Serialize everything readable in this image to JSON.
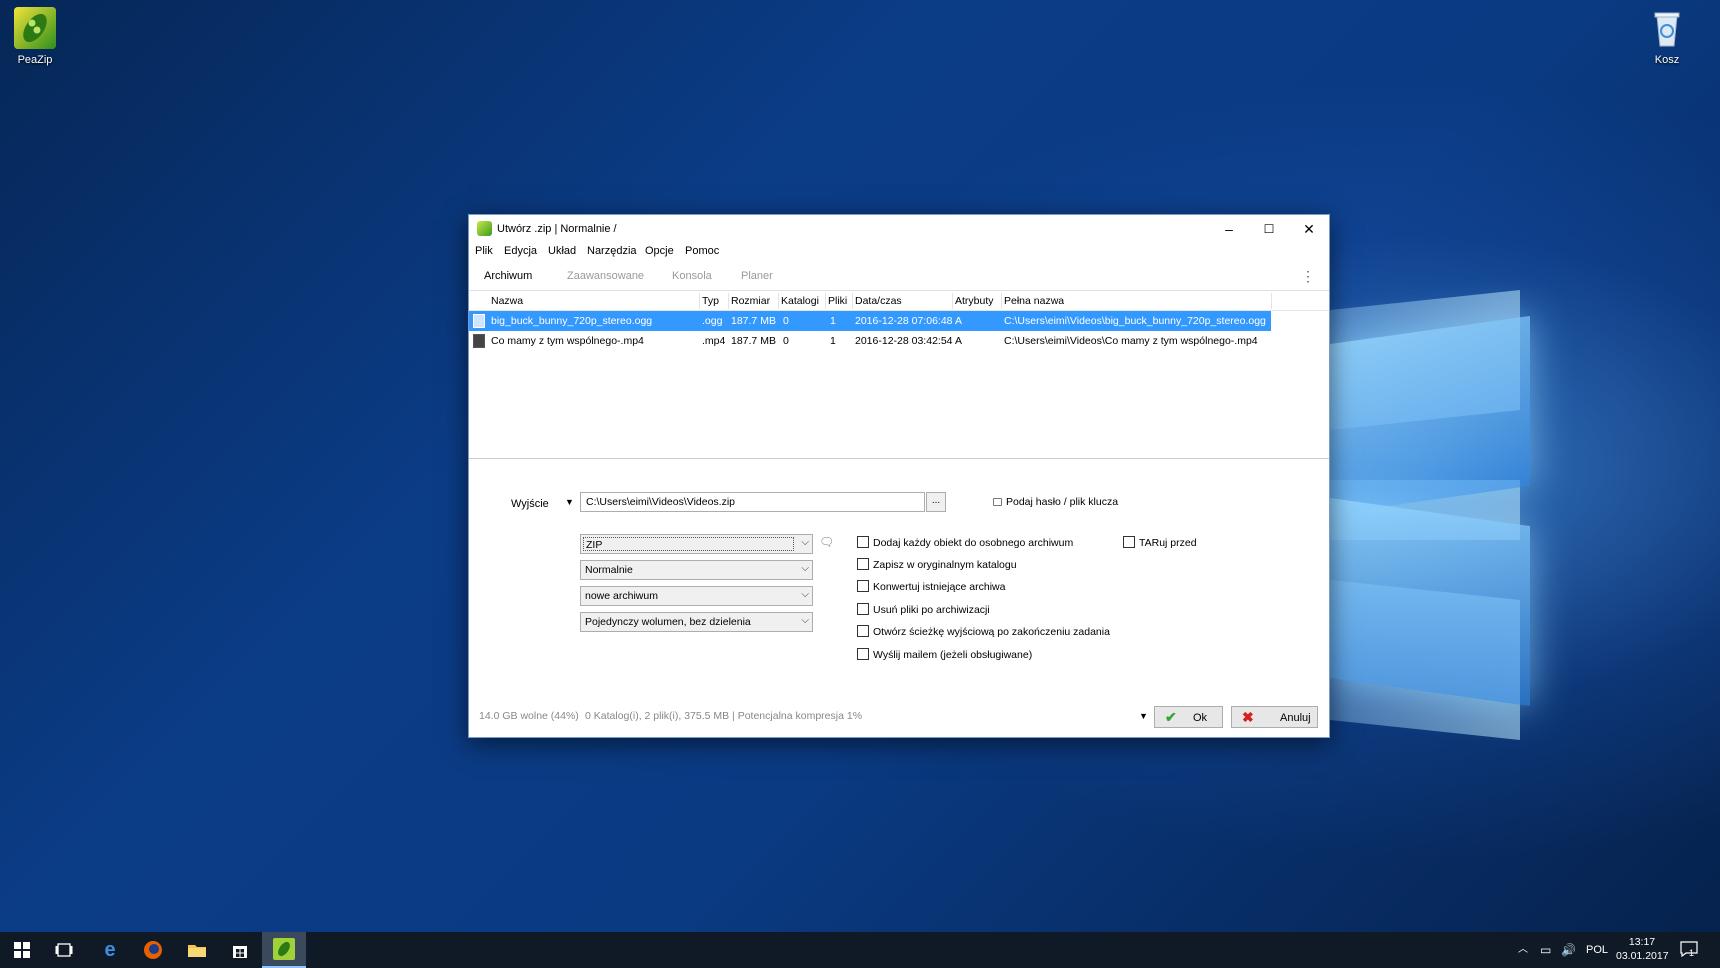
{
  "desktop": {
    "icons": [
      {
        "label": "PeaZip"
      },
      {
        "label": "Kosz"
      }
    ]
  },
  "window": {
    "title": "Utwórz .zip | Normalnie /",
    "controls": {
      "minimize": "–",
      "maximize": "☐",
      "close": "✕"
    },
    "menu": [
      "Plik",
      "Edycja",
      "Układ",
      "Narzędzia",
      "Opcje",
      "Pomoc"
    ],
    "tabs": [
      "Archiwum",
      "Zaawansowane",
      "Konsola",
      "Planer"
    ],
    "active_tab": "Archiwum",
    "list": {
      "columns": [
        "Nazwa",
        "Typ",
        "Rozmiar",
        "Katalogi",
        "Pliki",
        "Data/czas",
        "Atrybuty",
        "Pełna nazwa"
      ],
      "rows": [
        {
          "name": "big_buck_bunny_720p_stereo.ogg",
          "type": ".ogg",
          "size": "187.7 MB",
          "dirs": "0",
          "files": "1",
          "date": "2016-12-28 07:06:48",
          "attr": "A",
          "full": "C:\\Users\\eimi\\Videos\\big_buck_bunny_720p_stereo.ogg",
          "selected": true
        },
        {
          "name": "Co mamy z tym wspólnego-.mp4",
          "type": ".mp4",
          "size": "187.7 MB",
          "dirs": "0",
          "files": "1",
          "date": "2016-12-28 03:42:54",
          "attr": "A",
          "full": "C:\\Users\\eimi\\Videos\\Co mamy z tym wspólnego-.mp4",
          "selected": false
        }
      ]
    },
    "output": {
      "label": "Wyjście",
      "path": "C:\\Users\\eimi\\Videos\\Videos.zip",
      "browse": "...",
      "password": "Podaj hasło / plik klucza"
    },
    "selects": {
      "format": "ZIP",
      "level": "Normalnie",
      "mode": "nowe archiwum",
      "volume": "Pojedynczy wolumen, bez dzielenia"
    },
    "checkboxes": {
      "each_separate": "Dodaj każdy obiekt do osobnego archiwum",
      "tar_before": "TARuj przed",
      "save_original": "Zapisz w oryginalnym katalogu",
      "convert_existing": "Konwertuj istniejące archiwa",
      "delete_after": "Usuń pliki po archiwizacji",
      "open_output": "Otwórz ścieżkę wyjściową po zakończeniu zadania",
      "send_mail": "Wyślij mailem (jeżeli obsługiwane)"
    },
    "status": {
      "free": "14.0 GB wolne (44%)",
      "summary": "0 Katalog(i), 2 plik(i), 375.5 MB | Potencjalna kompresja 1%"
    },
    "buttons": {
      "ok": "Ok",
      "cancel": "Anuluj"
    }
  },
  "taskbar": {
    "lang": "POL",
    "time": "13:17",
    "date": "03.01.2017",
    "notifications": "1"
  },
  "colors": {
    "selection": "#3399ff",
    "ok_check": "#2eaa2e",
    "cancel_x": "#d42020",
    "taskbar": "#101a26"
  }
}
